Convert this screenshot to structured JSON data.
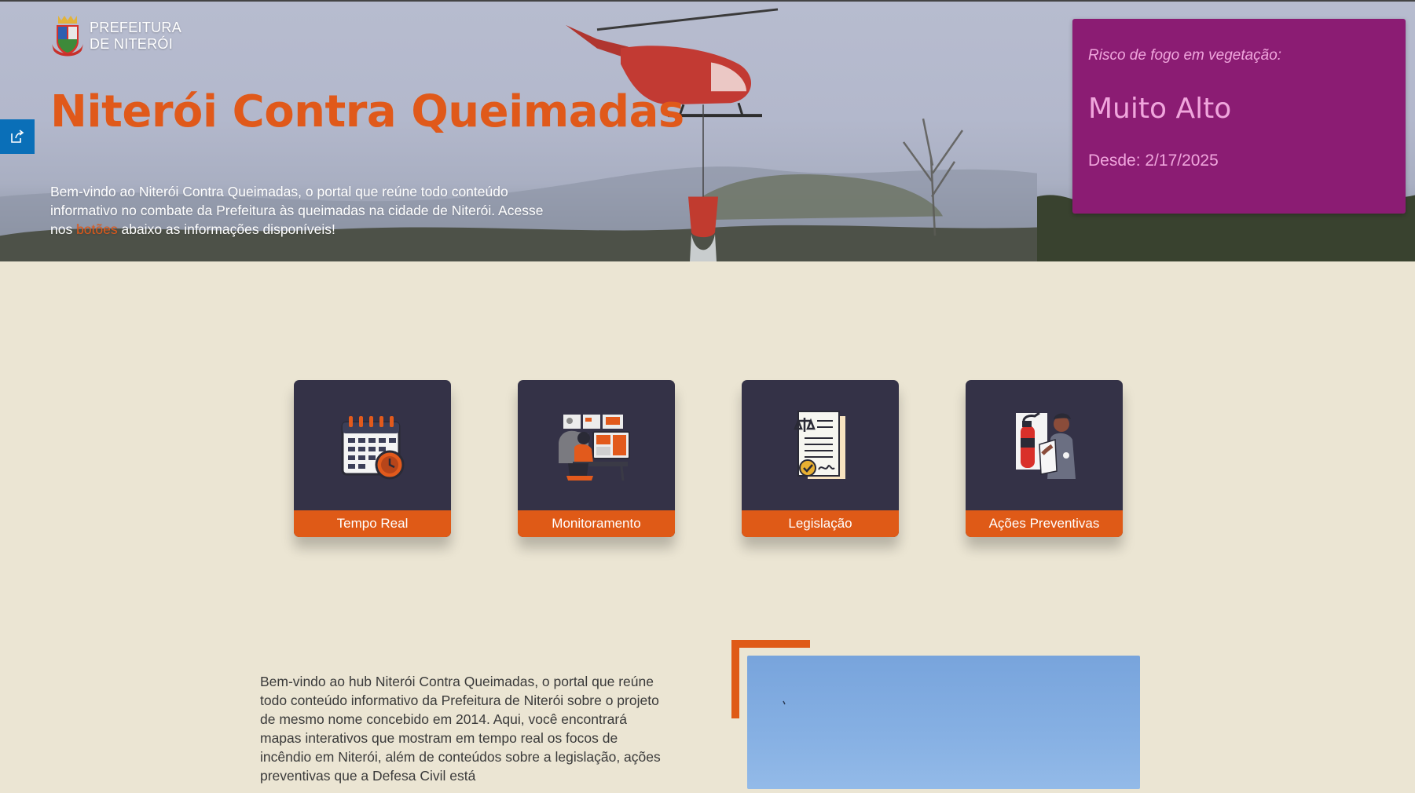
{
  "logo": {
    "line1": "PREFEITURA",
    "line2": "DE NITERÓI"
  },
  "hero": {
    "title": "Niterói Contra Queimadas",
    "intro_part1": "Bem-vindo ao Niterói Contra Queimadas, o portal que reúne todo conteúdo informativo no combate da Prefeitura às queimadas na cidade de Niterói. Acesse nos ",
    "intro_highlight": "botões",
    "intro_part2": " abaixo as informações disponíveis!"
  },
  "risk": {
    "label": "Risco de fogo em vegetação:",
    "level": "Muito Alto",
    "since": "Desde: 2/17/2025"
  },
  "cards": [
    {
      "label": "Tempo Real",
      "icon": "calendar-clock-icon"
    },
    {
      "label": "Monitoramento",
      "icon": "monitoring-desk-icon"
    },
    {
      "label": "Legislação",
      "icon": "legal-document-icon"
    },
    {
      "label": "Ações Preventivas",
      "icon": "fire-extinguisher-icon"
    }
  ],
  "about": {
    "text": "Bem-vindo ao hub Niterói Contra Queimadas, o portal que reúne todo conteúdo informativo da Prefeitura de Niterói sobre o projeto de mesmo nome concebido em 2014. Aqui, você encontrará mapas interativos que mostram em tempo real os focos de incêndio em Niterói, além de conteúdos sobre a legislação, ações preventivas que a Defesa Civil está"
  },
  "colors": {
    "accent": "#e0591a",
    "risk_card": "#8b1c73",
    "card_bg": "#343247",
    "page_bg": "#ebe5d3",
    "share_tab": "#0a6fb8"
  }
}
